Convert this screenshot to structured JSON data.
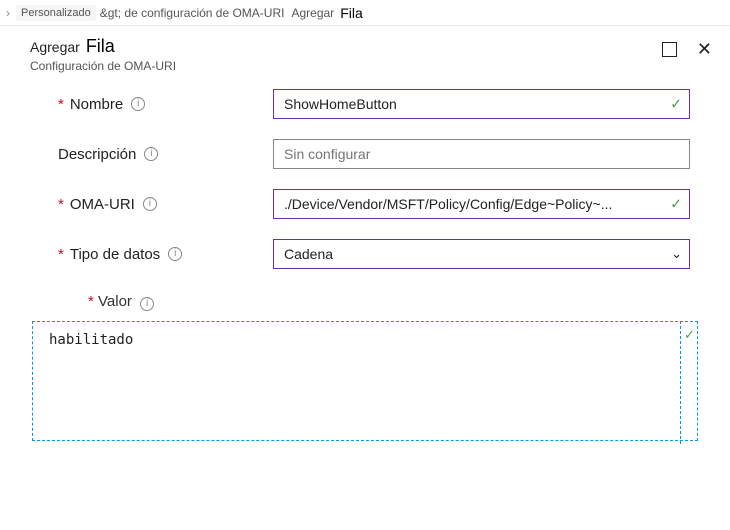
{
  "breadcrumb": {
    "item1": "Personalizado",
    "item2": "&gt; de configuración de OMA-URI",
    "item3_prefix": "Agregar",
    "item3_main": "Fila"
  },
  "header": {
    "title_prefix": "Agregar",
    "title_main": "Fila",
    "subtitle": "Configuración de OMA-URI"
  },
  "labels": {
    "nombre": "Nombre",
    "descripcion": "Descripción",
    "omauri": "OMA-URI",
    "tipo_datos": "Tipo de datos",
    "valor": "Valor"
  },
  "fields": {
    "nombre_value": "ShowHomeButton",
    "descripcion_placeholder": "Sin configurar",
    "omauri_value": "./Device/Vendor/MSFT/Policy/Config/Edge~Policy~...",
    "tipo_datos_value": "Cadena",
    "valor_value": "habilitado"
  }
}
